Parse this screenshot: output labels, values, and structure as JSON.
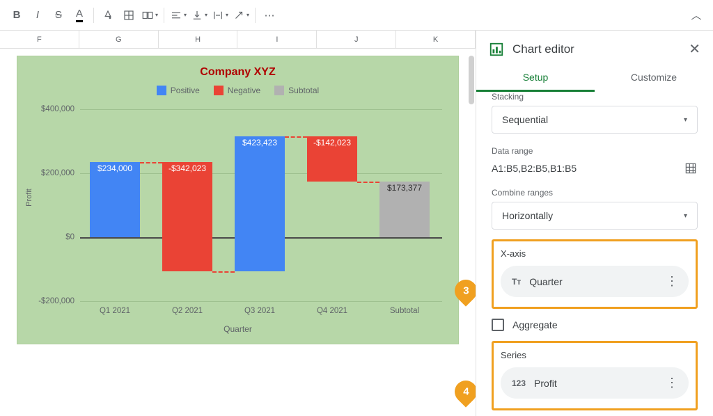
{
  "columns": [
    "F",
    "G",
    "H",
    "I",
    "J",
    "K"
  ],
  "chart_data": {
    "type": "bar",
    "title": "Company XYZ",
    "xlabel": "Quarter",
    "ylabel": "Profit",
    "ylim": [
      -200000,
      400000
    ],
    "yticks": [
      "$400,000",
      "$200,000",
      "$0",
      "-$200,000"
    ],
    "legend": [
      "Positive",
      "Negative",
      "Subtotal"
    ],
    "legend_colors": [
      "#4285f4",
      "#ea4335",
      "#b1b1b1"
    ],
    "categories": [
      "Q1 2021",
      "Q2 2021",
      "Q3 2021",
      "Q4 2021",
      "Subtotal"
    ],
    "value_labels": [
      "$234,000",
      "-$342,023",
      "$423,423",
      "-$142,023",
      "$173,377"
    ],
    "values": [
      234000,
      -342023,
      423423,
      -142023,
      173377
    ]
  },
  "panel": {
    "title": "Chart editor",
    "tabs": {
      "setup": "Setup",
      "customize": "Customize"
    },
    "stacking_label": "Stacking",
    "stacking_value": "Sequential",
    "datarange_label": "Data range",
    "datarange_value": "A1:B5,B2:B5,B1:B5",
    "combine_label": "Combine ranges",
    "combine_value": "Horizontally",
    "xaxis_label": "X-axis",
    "xaxis_value": "Quarter",
    "aggregate_label": "Aggregate",
    "series_label": "Series",
    "series_value": "Profit"
  },
  "callouts": {
    "three": "3",
    "four": "4"
  }
}
